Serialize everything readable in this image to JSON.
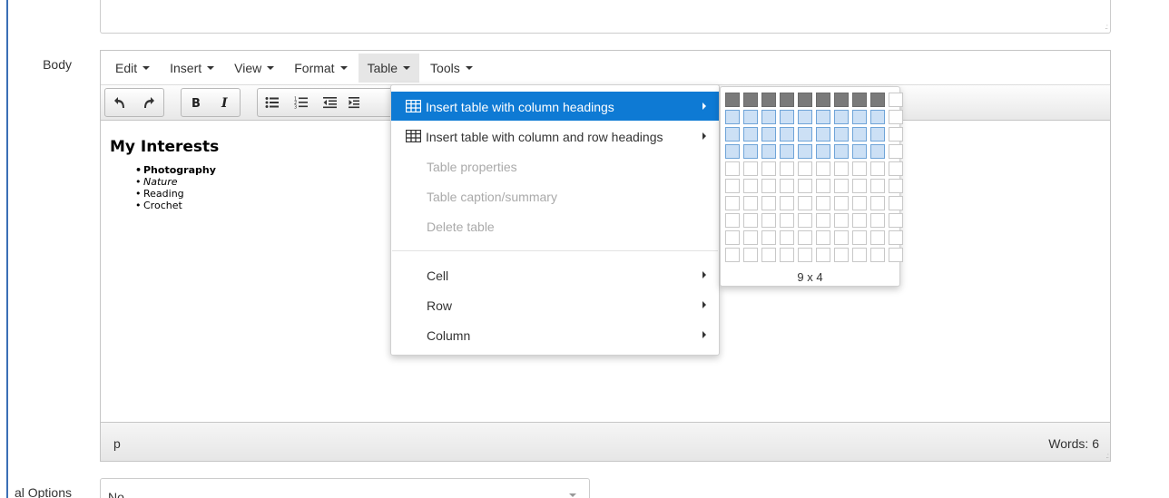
{
  "form": {
    "body_label": "Body",
    "options_label": "al Options",
    "options_value": "No"
  },
  "menubar": {
    "items": [
      {
        "label": "Edit"
      },
      {
        "label": "Insert"
      },
      {
        "label": "View"
      },
      {
        "label": "Format"
      },
      {
        "label": "Table"
      },
      {
        "label": "Tools"
      }
    ]
  },
  "toolbar": {
    "buttons": [
      "undo-icon",
      "redo-icon",
      "bold-icon",
      "italic-icon",
      "bullet-list-icon",
      "numbered-list-icon",
      "outdent-icon",
      "indent-icon"
    ]
  },
  "content": {
    "heading": "My Interests",
    "list": [
      "Photography",
      "Nature",
      "Reading",
      "Crochet"
    ]
  },
  "status": {
    "path": "p",
    "words": "Words: 6"
  },
  "table_menu": {
    "items": [
      {
        "label": "Insert table with column headings",
        "icon": "table-icon",
        "submenu": true,
        "state": "active"
      },
      {
        "label": "Insert table with column and row headings",
        "icon": "table-icon",
        "submenu": true,
        "state": "normal"
      },
      {
        "label": "Table properties",
        "state": "disabled"
      },
      {
        "label": "Table caption/summary",
        "state": "disabled"
      },
      {
        "label": "Delete table",
        "state": "disabled"
      },
      {
        "label": "Cell",
        "submenu": true,
        "state": "normal"
      },
      {
        "label": "Row",
        "submenu": true,
        "state": "normal"
      },
      {
        "label": "Column",
        "submenu": true,
        "state": "normal"
      }
    ]
  },
  "grid_picker": {
    "columns": 10,
    "rows": 10,
    "selected_columns": 9,
    "selected_rows": 4,
    "size_label": "9 x 4"
  },
  "colors": {
    "accent": "#0e7ad4",
    "selected_cell": "#cce0f5",
    "header_cell": "#7a7a7a",
    "page_border": "#3b6fb6"
  }
}
